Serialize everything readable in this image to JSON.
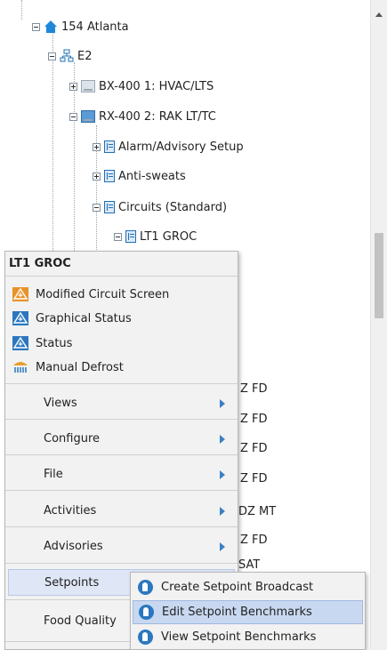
{
  "tree": {
    "site": "154 Atlanta",
    "controller": "E2",
    "boards": [
      "BX-400 1: HVAC/LTS",
      "RX-400 2: RAK LT/TC"
    ],
    "folders": [
      "Alarm/Advisory Setup",
      "Anti-sweats",
      "Circuits (Standard)"
    ],
    "circuit": "LT1 GROC",
    "partial_items": [
      "Z FD",
      "Z FD",
      "Z FD",
      "Z FD",
      "DZ MT",
      "Z FD",
      "SAT"
    ]
  },
  "context_menu": {
    "title": "LT1 GROC",
    "actions": [
      "Modified Circuit Screen",
      "Graphical Status",
      "Status",
      "Manual Defrost"
    ],
    "submenus": [
      "Views",
      "Configure",
      "File",
      "Activities",
      "Advisories",
      "Setpoints",
      "Food Quality"
    ]
  },
  "setpoints_submenu": {
    "items": [
      "Create Setpoint Broadcast",
      "Edit Setpoint Benchmarks",
      "View Setpoint Benchmarks"
    ]
  },
  "colors": {
    "accent": "#2b77bf",
    "highlight": "#dfe6f5",
    "home": "#1e88d8",
    "orange_icon": "#e8922a"
  }
}
